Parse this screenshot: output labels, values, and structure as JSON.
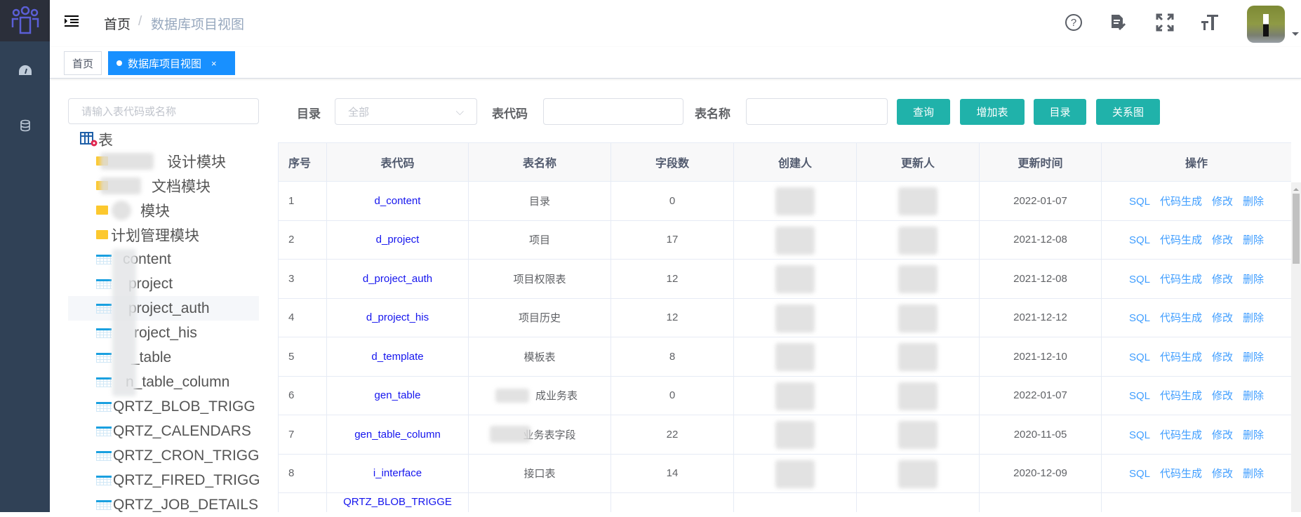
{
  "header": {
    "breadcrumb": [
      "首页",
      "数据库项目视图"
    ],
    "icons": [
      "help-icon",
      "document-edit-icon",
      "fullscreen-icon",
      "font-size-icon"
    ],
    "avatar": "user-avatar"
  },
  "sidebar": {
    "icons": [
      "dashboard-icon",
      "database-icon"
    ]
  },
  "tags": [
    {
      "label": "首页",
      "active": false
    },
    {
      "label": "数据库项目视图",
      "active": true,
      "close": "×"
    }
  ],
  "tree": {
    "search_placeholder": "请输入表代码或名称",
    "root": "表",
    "folders": [
      "设计模块",
      "文档模块",
      "模块",
      "计划管理模块"
    ],
    "tables": [
      "content",
      "project",
      "project_auth",
      "roject_his",
      "_table",
      "n_table_column",
      "QRTZ_BLOB_TRIGG",
      "QRTZ_CALENDARS",
      "QRTZ_CRON_TRIGG",
      "QRTZ_FIRED_TRIGG",
      "QRTZ_JOB_DETAILS"
    ],
    "selected": "project_auth"
  },
  "filters": {
    "catalog_label": "目录",
    "catalog_value": "全部",
    "code_label": "表代码",
    "code_value": "",
    "name_label": "表名称",
    "name_value": "",
    "buttons": [
      "查询",
      "增加表",
      "目录",
      "关系图"
    ]
  },
  "table": {
    "headers": [
      "序号",
      "表代码",
      "表名称",
      "字段数",
      "创建人",
      "更新人",
      "更新时间",
      "操作"
    ],
    "actions": [
      "SQL",
      "代码生成",
      "修改",
      "删除"
    ],
    "rows": [
      {
        "no": "1",
        "code": "d_content",
        "name": "目录",
        "fields": "0",
        "updated": "2022-01-07"
      },
      {
        "no": "2",
        "code": "d_project",
        "name": "项目",
        "fields": "17",
        "updated": "2021-12-08"
      },
      {
        "no": "3",
        "code": "d_project_auth",
        "name": "项目权限表",
        "fields": "12",
        "updated": "2021-12-08"
      },
      {
        "no": "4",
        "code": "d_project_his",
        "name": "项目历史",
        "fields": "12",
        "updated": "2021-12-12"
      },
      {
        "no": "5",
        "code": "d_template",
        "name": "模板表",
        "fields": "8",
        "updated": "2021-12-10"
      },
      {
        "no": "6",
        "code": "gen_table",
        "name": "成业务表",
        "fields": "0",
        "updated": "2022-01-07"
      },
      {
        "no": "7",
        "code": "gen_table_column",
        "name": "业务表字段",
        "fields": "22",
        "updated": "2020-11-05"
      },
      {
        "no": "8",
        "code": "i_interface",
        "name": "接口表",
        "fields": "14",
        "updated": "2020-12-09"
      },
      {
        "no": "",
        "code": "QRTZ_BLOB_TRIGGE",
        "name": "",
        "fields": "",
        "updated": ""
      }
    ]
  },
  "colors": {
    "sidebar": "#304156",
    "accent": "#20b2aa",
    "tag_active": "#1890ff",
    "link": "#409eff"
  }
}
